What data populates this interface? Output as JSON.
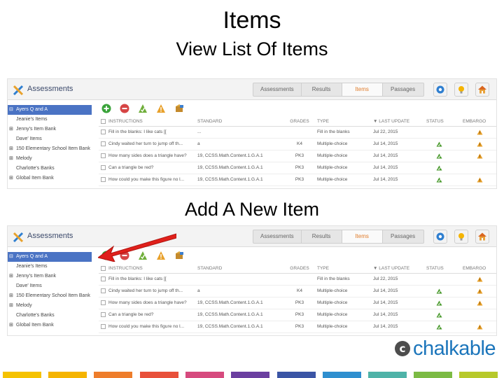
{
  "slide": {
    "title": "Items",
    "heading_view": "View List Of Items",
    "heading_add": "Add A New Item"
  },
  "app": {
    "title": "Assessments",
    "tabs": [
      {
        "label": "Assessments",
        "active": false
      },
      {
        "label": "Results",
        "active": false
      },
      {
        "label": "Items",
        "active": true
      },
      {
        "label": "Passages",
        "active": false
      }
    ],
    "toolbar_icons": [
      "settings-icon",
      "lightbulb-icon",
      "home-icon"
    ]
  },
  "sidebar": {
    "items": [
      {
        "label": "Ayers Q and A",
        "expand": "⊟",
        "active": true
      },
      {
        "label": "Jeanie's Items",
        "expand": "",
        "active": false
      },
      {
        "label": "Jenny's Item Bank",
        "expand": "⊞",
        "active": false
      },
      {
        "label": "Dave' Items",
        "expand": "",
        "active": false
      },
      {
        "label": "150 Elementary School Item Bank",
        "expand": "⊞",
        "active": false
      },
      {
        "label": "Melody",
        "expand": "⊞",
        "active": false
      },
      {
        "label": "Charlotte's Banks",
        "expand": "",
        "active": false
      },
      {
        "label": "Global Item Bank",
        "expand": "⊞",
        "active": false
      }
    ]
  },
  "actions": [
    "add-icon",
    "remove-icon",
    "approve-icon",
    "warning-icon",
    "package-icon"
  ],
  "table": {
    "headers": {
      "instructions": "INSTRUCTIONS",
      "standard": "STANDARD",
      "grades": "GRADES",
      "type": "TYPE",
      "last_update": "▼ LAST UPDATE",
      "status": "STATUS",
      "embargo": "EMBARGO"
    },
    "rows_view": [
      {
        "instructions": "Fill in the blanks: I like cats [[",
        "standard": "...",
        "grade": "",
        "type": "Fill in the blanks",
        "updated": "Jul 22, 2015",
        "status": false,
        "embargo": true
      },
      {
        "instructions": "Cindy waited her turn to jump off th...",
        "standard": "a",
        "grade": "K4",
        "type": "Multiple-choice",
        "updated": "Jul 14, 2015",
        "status": true,
        "embargo": true
      },
      {
        "instructions": "How many sides does a triangle have?",
        "standard": "19, CCSS.Math.Content.1.G.A.1",
        "grade": "PK3",
        "type": "Multiple-choice",
        "updated": "Jul 14, 2015",
        "status": true,
        "embargo": true
      },
      {
        "instructions": "Can a triangle be red?",
        "standard": "19, CCSS.Math.Content.1.G.A.1",
        "grade": "PK3",
        "type": "Multiple-choice",
        "updated": "Jul 14, 2015",
        "status": true,
        "embargo": false
      },
      {
        "instructions": "How could you make this figure no l...",
        "standard": "19, CCSS.Math.Content.1.G.A.1",
        "grade": "PK3",
        "type": "Multiple-choice",
        "updated": "Jul 14, 2015",
        "status": true,
        "embargo": true
      }
    ],
    "rows_add": [
      {
        "instructions": "Fill in the blanks: I like cats [[",
        "standard": "",
        "grade": "",
        "type": "Fill in the blanks",
        "updated": "Jul 22, 2015",
        "status": false,
        "embargo": true
      },
      {
        "instructions": "Cindy waited her turn to jump off th...",
        "standard": "a",
        "grade": "K4",
        "type": "Multiple-choice",
        "updated": "Jul 14, 2015",
        "status": true,
        "embargo": true
      },
      {
        "instructions": "How many sides does a triangle have?",
        "standard": "19, CCSS.Math.Content.1.G.A.1",
        "grade": "PK3",
        "type": "Multiple-choice",
        "updated": "Jul 14, 2015",
        "status": true,
        "embargo": true
      },
      {
        "instructions": "Can a triangle be red?",
        "standard": "19, CCSS.Math.Content.1.G.A.1",
        "grade": "PK3",
        "type": "Multiple-choice",
        "updated": "Jul 14, 2015",
        "status": true,
        "embargo": false
      },
      {
        "instructions": "How could you make this figure no l...",
        "standard": "19, CCSS.Math.Content.1.G.A.1",
        "grade": "PK3",
        "type": "Multiple-choice",
        "updated": "Jul 14, 2015",
        "status": true,
        "embargo": true
      }
    ]
  },
  "logo": {
    "mark": "c",
    "text": "chalkable"
  },
  "colors": {
    "accent_blue": "#4a73c4",
    "active_tab": "#e07b2a",
    "logo_blue": "#1b75bb",
    "arrow_red": "#e0201b",
    "footer_bars": [
      "#f5c200",
      "#f5b400",
      "#ee7d2b",
      "#e8503a",
      "#d64a7e",
      "#6b3fa0",
      "#3b55a5",
      "#2f8fcf",
      "#4fb3a8",
      "#7cbb44",
      "#b7c92b"
    ]
  }
}
